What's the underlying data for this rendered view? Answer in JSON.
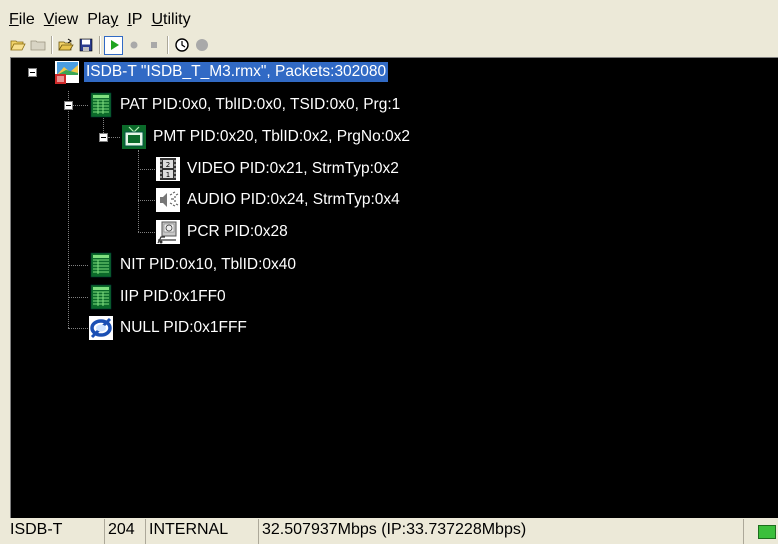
{
  "menu": {
    "file": {
      "accel": "F",
      "rest": "ile"
    },
    "view": {
      "accel": "V",
      "rest": "iew"
    },
    "play": {
      "pre": "Pla",
      "accel": "y",
      "rest": ""
    },
    "ip": {
      "accel": "I",
      "rest": "P"
    },
    "utility": {
      "accel": "U",
      "rest": "tility"
    }
  },
  "toolbar": {
    "buttons": [
      "folder-open-icon",
      "folder-icon",
      "open-icon",
      "save-icon",
      "play-icon",
      "record-icon",
      "stop-icon",
      "clock-icon",
      "circle-icon"
    ]
  },
  "tree": {
    "nodes": [
      {
        "label": "ISDB-T \"ISDB_T_M3.rmx\", Packets:302080",
        "icon": "stream-file-icon",
        "selected": true
      },
      {
        "label": "PAT PID:0x0, TblID:0x0, TSID:0x0, Prg:1",
        "icon": "table-icon"
      },
      {
        "label": "PMT PID:0x20, TblID:0x2, PrgNo:0x2",
        "icon": "tv-program-icon"
      },
      {
        "label": "VIDEO PID:0x21, StrmTyp:0x2",
        "icon": "video-film-icon"
      },
      {
        "label": "AUDIO PID:0x24, StrmTyp:0x4",
        "icon": "audio-speaker-icon"
      },
      {
        "label": "PCR PID:0x28",
        "icon": "pcr-clock-icon"
      },
      {
        "label": "NIT PID:0x10, TblID:0x40",
        "icon": "table-icon"
      },
      {
        "label": "IIP PID:0x1FF0",
        "icon": "table-icon"
      },
      {
        "label": "NULL PID:0x1FFF",
        "icon": "null-packet-icon"
      }
    ]
  },
  "status": {
    "standard": "ISDB-T",
    "packet_size": "204",
    "source": "INTERNAL",
    "bitrate": "32.507937Mbps (IP:33.737228Mbps)"
  },
  "colors": {
    "tree_bg": "#000000",
    "text": "#ffffff",
    "selection": "#316ac5",
    "chrome": "#ece9d8"
  }
}
